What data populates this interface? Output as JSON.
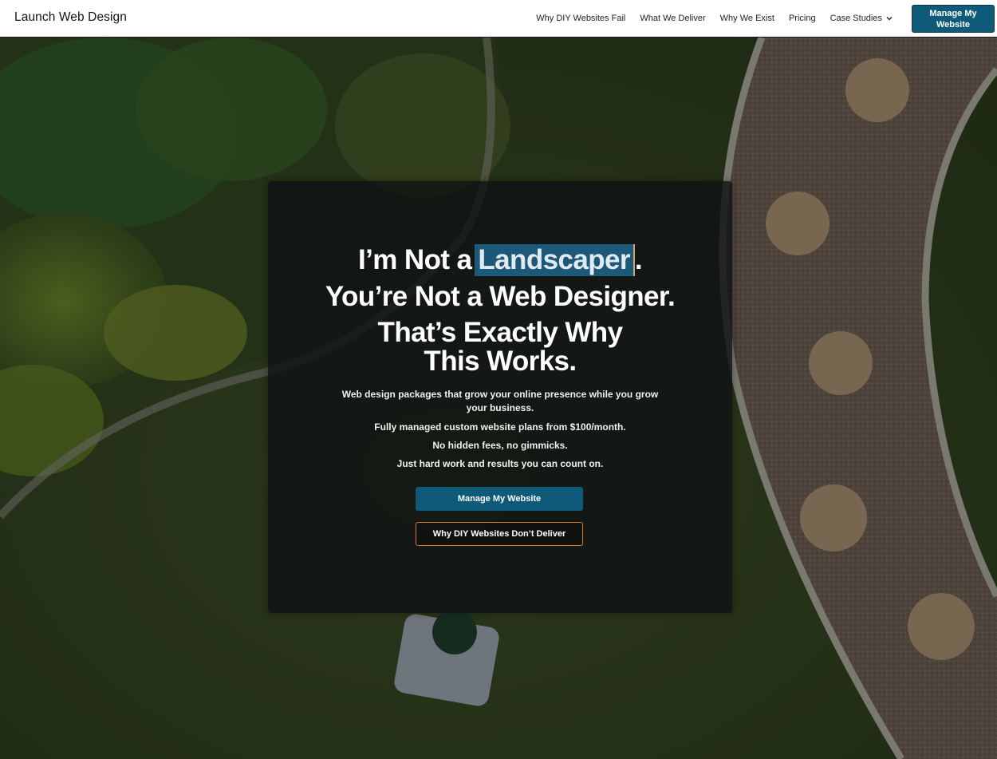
{
  "header": {
    "logo": "Launch Web Design",
    "nav": [
      {
        "label": "Why DIY Websites Fail"
      },
      {
        "label": "What We Deliver"
      },
      {
        "label": "Why We Exist"
      },
      {
        "label": "Pricing"
      },
      {
        "label": "Case Studies",
        "has_dropdown": true
      }
    ],
    "cta": "Manage My Website",
    "cta_color": "#0f5a78"
  },
  "hero": {
    "headline_prefix": "I’m Not a",
    "headline_highlight": "Landscaper",
    "headline_suffix": ".",
    "headline_line2": "You’re Not a Web Designer.",
    "headline_line3a": "That’s Exactly Why",
    "headline_line3b": "This Works.",
    "sub1": "Web design packages that grow your online presence while you grow your business.",
    "sub2": "Fully managed custom website plans from $100/month.",
    "sub3": "No hidden fees, no gimmicks.",
    "sub4": "Just hard work and results you can count on.",
    "primary_button": "Manage My Website",
    "secondary_button": "Why DIY Websites Don’t Deliver",
    "primary_color": "#0e5a78",
    "outline_color": "#d47a2d",
    "background_image": "aerial-lawn-mowing-scene"
  }
}
